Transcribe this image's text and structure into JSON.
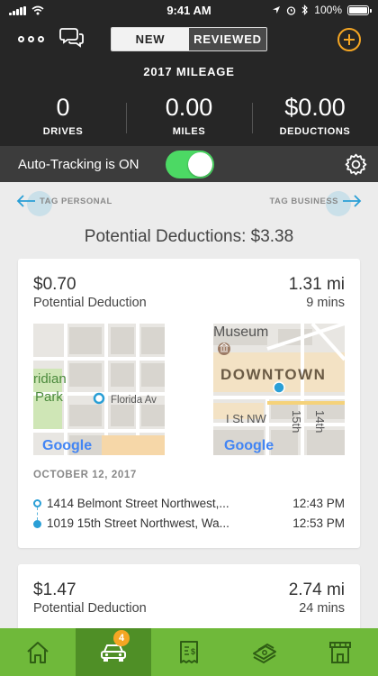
{
  "status_bar": {
    "time": "9:41 AM",
    "battery": "100%"
  },
  "header": {
    "segments": [
      {
        "label": "NEW",
        "active": true
      },
      {
        "label": "REVIEWED",
        "active": false
      }
    ],
    "title": "2017 MILEAGE",
    "stats": [
      {
        "value": "0",
        "label": "DRIVES"
      },
      {
        "value": "0.00",
        "label": "MILES"
      },
      {
        "value": "$0.00",
        "label": "DEDUCTIONS"
      }
    ]
  },
  "auto_tracking": {
    "label": "Auto-Tracking is ON",
    "enabled": true
  },
  "tags": {
    "left": "TAG PERSONAL",
    "right": "TAG BUSINESS"
  },
  "potential_total": "Potential Deductions: $3.38",
  "trips": [
    {
      "amount": "$0.70",
      "amount_label": "Potential Deduction",
      "miles": "1.31 mi",
      "duration": "9 mins",
      "start_map": {
        "labels": [
          "ridian",
          "Park",
          "Florida Av"
        ],
        "provider": "Google"
      },
      "end_map": {
        "labels": [
          "Museum",
          "DOWNTOWN",
          "I St NW",
          "15th",
          "14th"
        ],
        "provider": "Google"
      },
      "date": "OCTOBER 12, 2017",
      "start": {
        "address": "1414 Belmont Street Northwest,...",
        "time": "12:43 PM"
      },
      "end": {
        "address": "1019 15th Street Northwest, Wa...",
        "time": "12:53 PM"
      }
    },
    {
      "amount": "$1.47",
      "amount_label": "Potential Deduction",
      "miles": "2.74 mi",
      "duration": "24 mins"
    }
  ],
  "tab_bar": {
    "tabs": [
      {
        "name": "home",
        "icon": "home-icon",
        "active": false
      },
      {
        "name": "drives",
        "icon": "car-icon",
        "active": true,
        "badge": "4"
      },
      {
        "name": "receipts",
        "icon": "receipt-icon",
        "active": false
      },
      {
        "name": "money",
        "icon": "money-stack-icon",
        "active": false
      },
      {
        "name": "store",
        "icon": "store-icon",
        "active": false
      }
    ]
  },
  "colors": {
    "header_bg": "#262626",
    "accent_orange": "#f5a623",
    "accent_blue": "#2a9fd6",
    "toggle_green": "#4cd964",
    "tab_green": "#6fb93a",
    "tab_active": "#4f8f26"
  }
}
